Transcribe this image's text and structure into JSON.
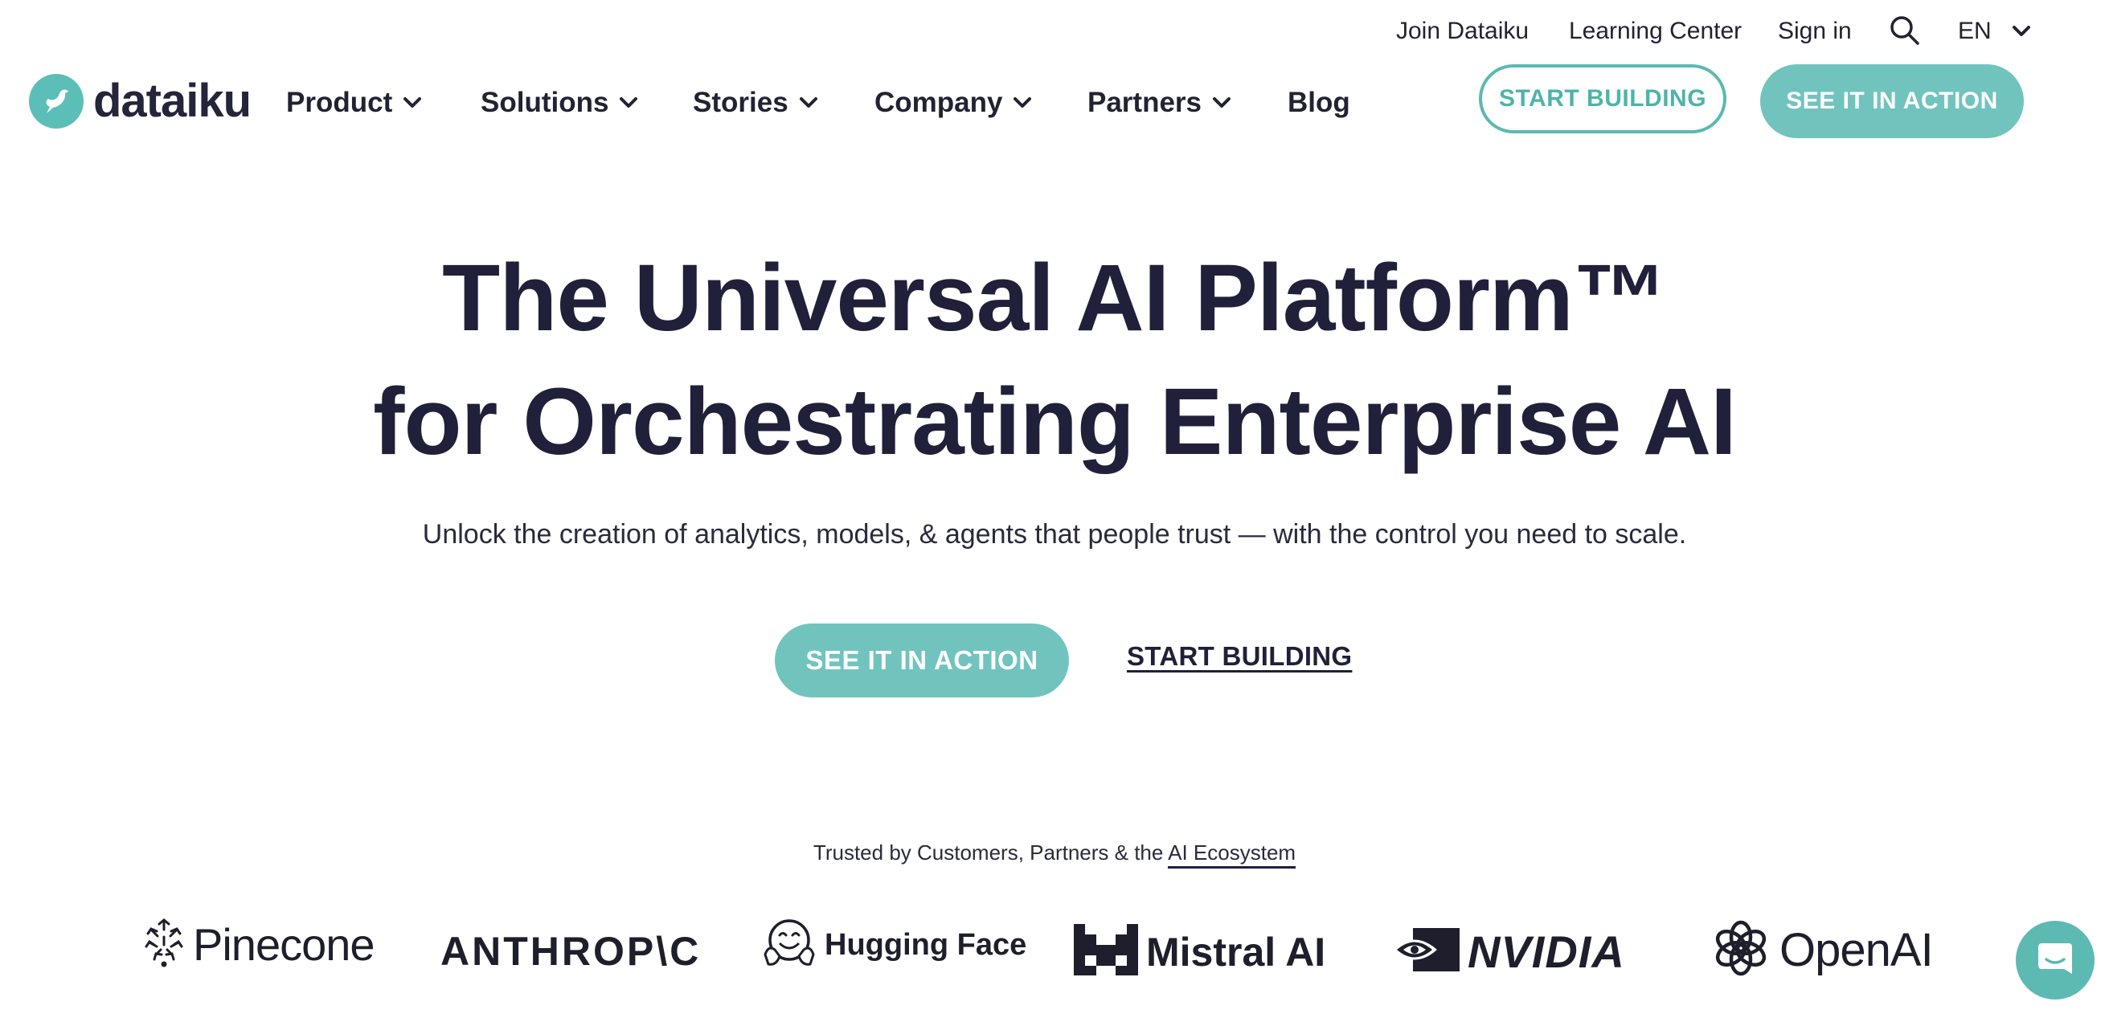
{
  "topbar": {
    "links": [
      "Join Dataiku",
      "Learning Center",
      "Sign in"
    ],
    "language": "EN"
  },
  "logo": {
    "text": "dataiku"
  },
  "nav": {
    "items": [
      {
        "label": "Product",
        "dropdown": true
      },
      {
        "label": "Solutions",
        "dropdown": true
      },
      {
        "label": "Stories",
        "dropdown": true
      },
      {
        "label": "Company",
        "dropdown": true
      },
      {
        "label": "Partners",
        "dropdown": true
      },
      {
        "label": "Blog",
        "dropdown": false
      }
    ],
    "start_building": "START BUILDING",
    "see_it_in_action": "SEE IT IN ACTION"
  },
  "hero": {
    "title_line1": "The Universal AI Platform™",
    "title_line2": "for Orchestrating Enterprise AI",
    "subtitle": "Unlock the creation of analytics, models, & agents that people trust — with the control you need to scale.",
    "cta_primary": "SEE IT IN ACTION",
    "cta_secondary": "START BUILDING"
  },
  "trusted": {
    "text": "Trusted by Customers, Partners & the ",
    "link": "AI Ecosystem"
  },
  "partners": [
    {
      "name": "Pinecone",
      "icon": "pinecone-icon"
    },
    {
      "name": "ANTHROP\\C",
      "icon": ""
    },
    {
      "name": "Hugging Face",
      "icon": "hugging-face-icon"
    },
    {
      "name": "Mistral AI",
      "icon": "mistral-icon"
    },
    {
      "name": "NVIDIA",
      "icon": "nvidia-eye-icon"
    },
    {
      "name": "OpenAI",
      "icon": "openai-knot-icon"
    }
  ],
  "colors": {
    "accent": "#71c4be",
    "accent_dark": "#4fb3aa",
    "text": "#20203a"
  }
}
